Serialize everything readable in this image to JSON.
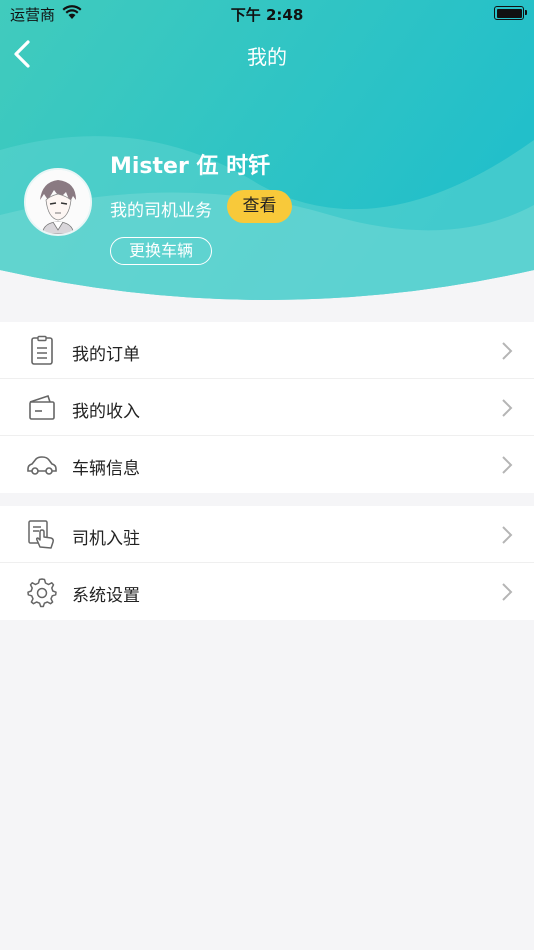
{
  "status_bar": {
    "carrier": "运营商",
    "time": "下午 2:48"
  },
  "nav": {
    "title": "我的"
  },
  "profile": {
    "name": "Mister 伍 时钎",
    "business_label": "我的司机业务",
    "view_label": "查看",
    "change_vehicle_label": "更换车辆"
  },
  "menu_group_1": [
    {
      "label": "我的订单",
      "icon": "clipboard-icon"
    },
    {
      "label": "我的收入",
      "icon": "wallet-icon"
    },
    {
      "label": "车辆信息",
      "icon": "car-icon"
    }
  ],
  "menu_group_2": [
    {
      "label": "司机入驻",
      "icon": "hand-tap-icon"
    },
    {
      "label": "系统设置",
      "icon": "gear-icon"
    }
  ],
  "colors": {
    "header_start": "#3cc6bd",
    "header_end": "#27c0c9",
    "accent": "#f8c93a"
  }
}
